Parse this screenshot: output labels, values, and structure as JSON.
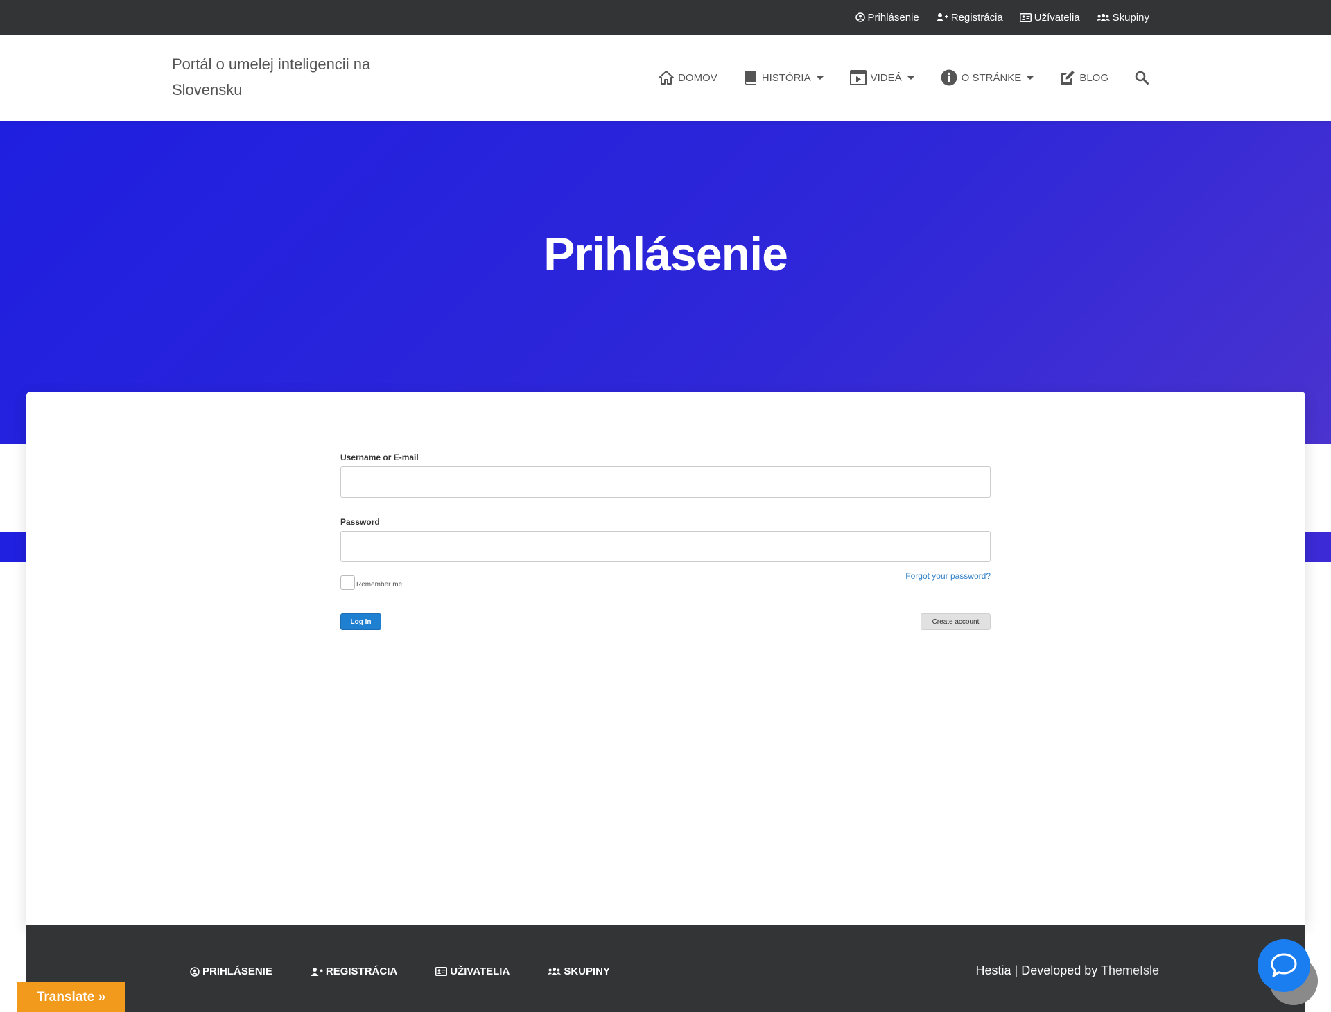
{
  "topbar": {
    "items": [
      {
        "label": "Prihlásenie",
        "icon": "user-circle-icon"
      },
      {
        "label": "Registrácia",
        "icon": "user-plus-icon"
      },
      {
        "label": "Užívatelia",
        "icon": "id-card-icon"
      },
      {
        "label": "Skupiny",
        "icon": "users-icon"
      }
    ]
  },
  "header": {
    "brand": "Portál o umelej inteligencii na Slovensku",
    "nav": [
      {
        "label": "DOMOV",
        "icon": "home-icon",
        "dropdown": false
      },
      {
        "label": "HISTÓRIA",
        "icon": "book-icon",
        "dropdown": true
      },
      {
        "label": "VIDEÁ",
        "icon": "film-icon",
        "dropdown": true
      },
      {
        "label": "O STRÁNKE",
        "icon": "info-circle-icon",
        "dropdown": true
      },
      {
        "label": "BLOG",
        "icon": "edit-icon",
        "dropdown": false
      }
    ],
    "search_icon": "search-icon"
  },
  "hero": {
    "title": "Prihlásenie",
    "gradient": [
      "#1f1fe0",
      "#4a33cf"
    ]
  },
  "login_form": {
    "username_label": "Username or E-mail",
    "username_value": "",
    "password_label": "Password",
    "password_value": "",
    "remember_label": "Remember me",
    "remember_checked": false,
    "forgot_link": "Forgot your password?",
    "login_button": "Log In",
    "create_button": "Create account"
  },
  "footer": {
    "nav": [
      {
        "label": "PRIHLÁSENIE",
        "icon": "user-circle-icon"
      },
      {
        "label": "REGISTRÁCIA",
        "icon": "user-plus-icon"
      },
      {
        "label": "UŽIVATELIA",
        "icon": "id-card-icon"
      },
      {
        "label": "SKUPINY",
        "icon": "users-icon"
      }
    ],
    "credits_prefix": "Hestia | Developed by ",
    "credits_link": "ThemeIsle"
  },
  "translate_widget": {
    "label": "Translate »"
  },
  "colors": {
    "topbar_bg": "#333436",
    "accent_blue": "#1f7fd0",
    "translate_orange": "#f29a1b",
    "chat_blue": "#1b7ef0"
  }
}
